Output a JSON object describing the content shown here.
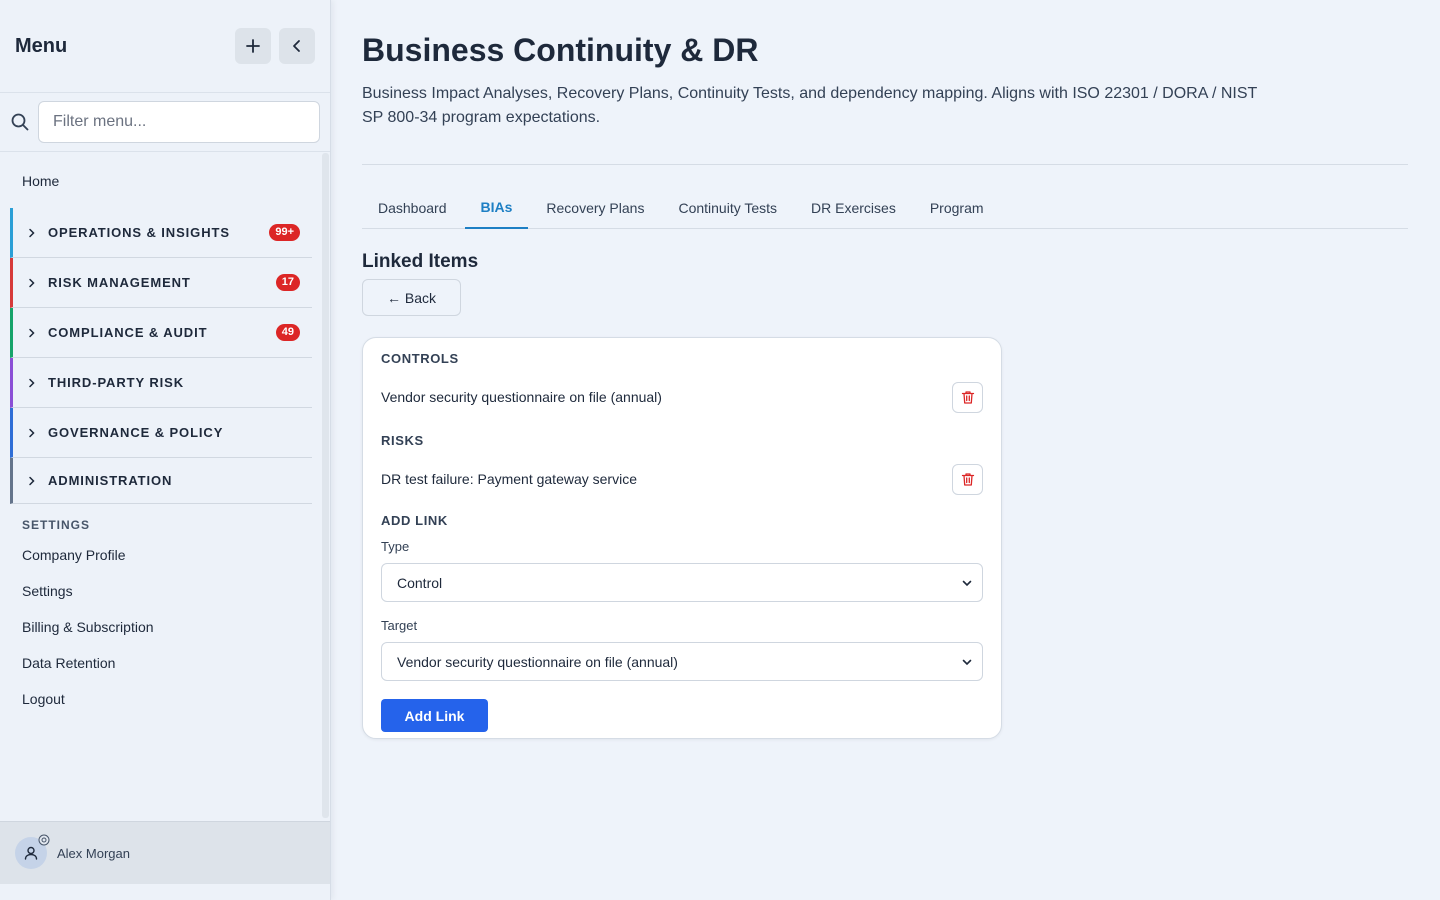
{
  "sidebar": {
    "title": "Menu",
    "filter_placeholder": "Filter menu...",
    "home": "Home",
    "groups": [
      {
        "label": "OPERATIONS & INSIGHTS",
        "badge": "99+",
        "color": "#2b9fd6"
      },
      {
        "label": "RISK MANAGEMENT",
        "badge": "17",
        "color": "#d63a3a"
      },
      {
        "label": "COMPLIANCE & AUDIT",
        "badge": "49",
        "color": "#16a36a"
      },
      {
        "label": "THIRD-PARTY RISK",
        "badge": "",
        "color": "#8b4fd6"
      },
      {
        "label": "GOVERNANCE & POLICY",
        "badge": "",
        "color": "#2f6ed6"
      },
      {
        "label": "ADMINISTRATION",
        "badge": "",
        "color": "#64748b"
      }
    ],
    "settings_label": "SETTINGS",
    "settings_items": [
      "Company Profile",
      "Settings",
      "Billing & Subscription",
      "Data Retention",
      "Logout"
    ],
    "user_name": "Alex Morgan"
  },
  "main": {
    "title": "Business Continuity & DR",
    "description": "Business Impact Analyses, Recovery Plans, Continuity Tests, and dependency mapping. Aligns with ISO 22301 / DORA / NIST SP 800-34 program expectations.",
    "tabs": [
      "Dashboard",
      "BIAs",
      "Recovery Plans",
      "Continuity Tests",
      "DR Exercises",
      "Program"
    ],
    "active_tab": "BIAs",
    "section_title": "Linked Items",
    "back_label": "← Back",
    "controls_label": "CONTROLS",
    "control_item": "Vendor security questionnaire on file (annual)",
    "risks_label": "RISKS",
    "risk_item": "DR test failure: Payment gateway service",
    "add_link_label": "ADD LINK",
    "type_label": "Type",
    "type_value": "Control",
    "target_label": "Target",
    "target_value": "Vendor security questionnaire on file (annual)",
    "add_link_button": "Add Link"
  }
}
